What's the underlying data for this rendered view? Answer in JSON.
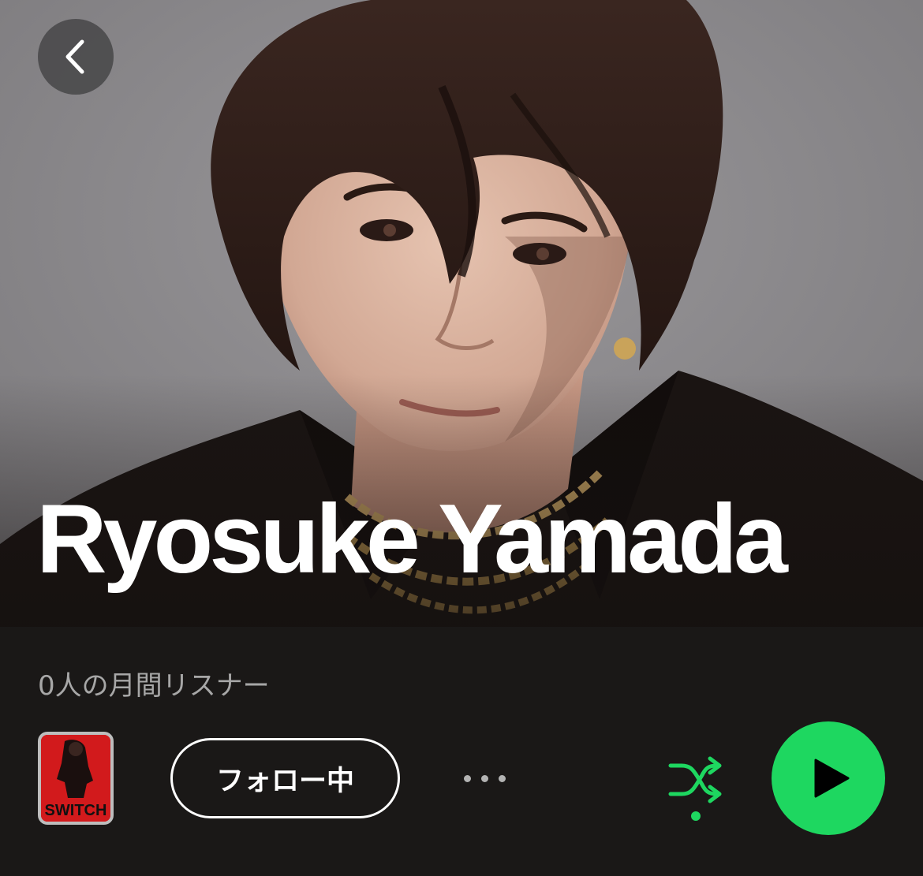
{
  "hero": {
    "artist_name": "Ryosuke Yamada",
    "back_icon": "chevron-left-icon"
  },
  "info": {
    "monthly_listeners": "0人の月間リスナー"
  },
  "actions": {
    "album_thumb_text": "SWITCH",
    "follow_label": "フォロー中",
    "more_icon": "more-horizontal-icon",
    "shuffle_icon": "shuffle-icon",
    "shuffle_active": true,
    "play_icon": "play-icon"
  },
  "colors": {
    "accent": "#1ed760",
    "background": "#1f1c1b",
    "text_primary": "#ffffff",
    "text_secondary": "#a7a7a7"
  }
}
